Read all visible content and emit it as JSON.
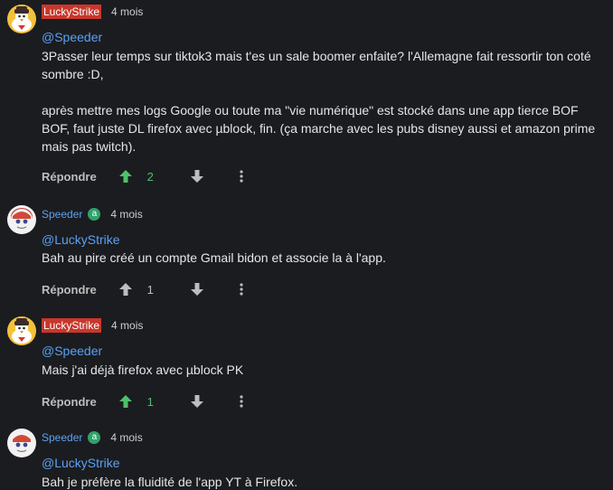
{
  "comments": [
    {
      "author": "LuckyStrike",
      "badge": "",
      "time": "4 mois",
      "mention": "@Speeder",
      "paragraphs": [
        "3Passer leur temps sur tiktok3 mais t'es un sale boomer enfaite? l'Allemagne fait ressortir ton coté sombre :D,",
        "après mettre mes logs Google ou toute ma \"vie numérique\" est stocké dans une app tierce BOF BOF, faut juste DL firefox avec µblock, fin. (ça marche avec les pubs disney aussi et amazon prime mais pas twitch)."
      ],
      "reply_label": "Répondre",
      "likes": "2",
      "upvoted": true
    },
    {
      "author": "Speeder",
      "badge": "a",
      "time": "4 mois",
      "mention": "@LuckyStrike",
      "paragraphs": [
        "Bah au pire créé un compte Gmail bidon et associe la à l'app."
      ],
      "reply_label": "Répondre",
      "likes": "1",
      "upvoted": false
    },
    {
      "author": "LuckyStrike",
      "badge": "",
      "time": "4 mois",
      "mention": "@Speeder",
      "paragraphs": [
        "Mais j'ai déjà firefox avec µblock PK"
      ],
      "reply_label": "Répondre",
      "likes": "1",
      "upvoted": true
    },
    {
      "author": "Speeder",
      "badge": "a",
      "time": "4 mois",
      "mention": "@LuckyStrike",
      "paragraphs": [
        "Bah je préfère la fluidité de l'app YT à Firefox."
      ]
    }
  ],
  "colors": {
    "background": "#1b1c20",
    "highlight_author": "#c8372b",
    "mention": "#5aa1f2",
    "upvote_active": "#4fc06a",
    "badge": "#2fa36b"
  }
}
